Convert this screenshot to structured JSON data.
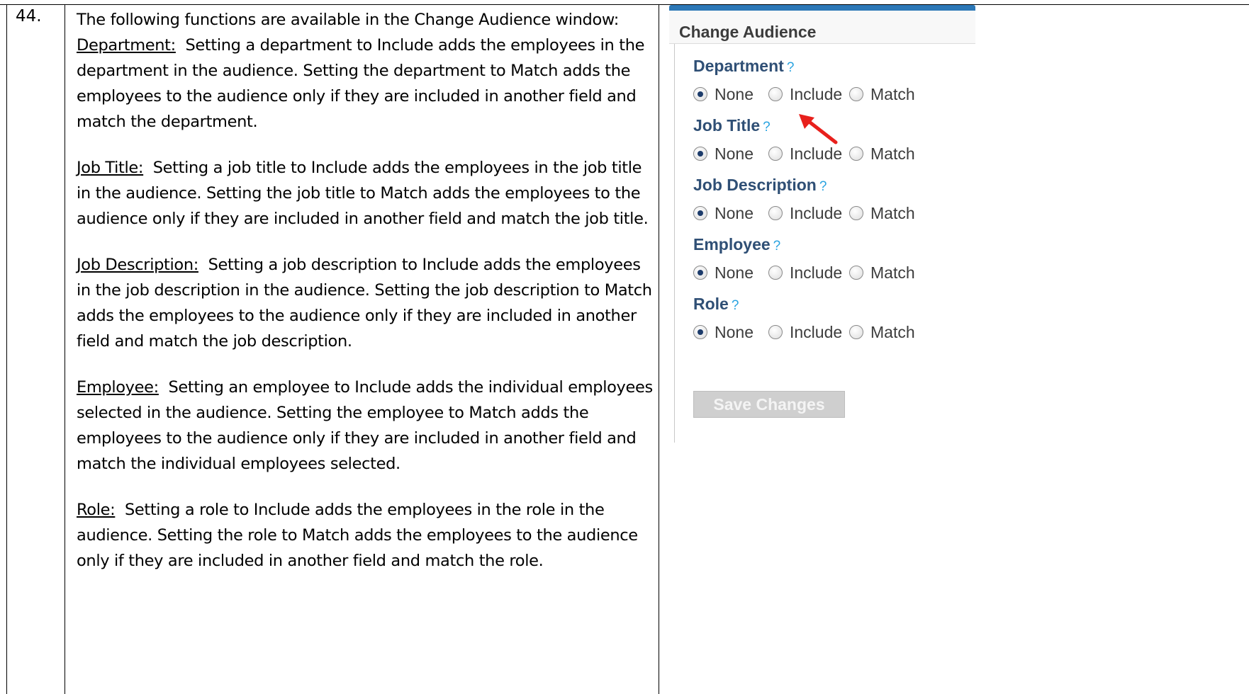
{
  "step": {
    "number": "44."
  },
  "description": {
    "intro": "The following functions are available in the Change Audience window:",
    "items": [
      {
        "term": "Department:",
        "text": "Setting a department to Include adds the employees in the department in the audience.  Setting the department to Match adds the employees to the audience only if they are included in another field and match the department."
      },
      {
        "term": "Job Title:",
        "text": "Setting a job title to Include adds the employees in the job title in the audience.  Setting the job title to Match adds the employees to the audience only if they are included in another field and match the job title."
      },
      {
        "term": "Job Description:",
        "text": "Setting a job description to Include adds the employees in the job description in the audience.  Setting the job description to Match adds the employees to the audience only if they are included in another field and match the job description."
      },
      {
        "term": "Employee:",
        "text": "Setting an employee to Include adds the individual employees selected in the audience.  Setting the employee to Match adds the employees to the audience only if they are included in another field and match the individual employees selected."
      },
      {
        "term": "Role:",
        "text": "Setting a role to Include adds the employees in the role in the audience.  Setting the role to Match adds the employees to the audience only if they are included in another field and match the role."
      }
    ]
  },
  "panel": {
    "title": "Change Audience",
    "help_mark": "?",
    "option_labels": [
      "None",
      "Include",
      "Match"
    ],
    "fields": [
      {
        "label": "Department",
        "selected": "None"
      },
      {
        "label": "Job Title",
        "selected": "None"
      },
      {
        "label": "Job Description",
        "selected": "None"
      },
      {
        "label": "Employee",
        "selected": "None"
      },
      {
        "label": "Role",
        "selected": "None"
      }
    ],
    "save_label": "Save Changes",
    "colors": {
      "header_bar": "#2c78b7",
      "field_label": "#2f4f75",
      "help_mark": "#29a3e0",
      "annotation_arrow": "#e8201c"
    }
  }
}
